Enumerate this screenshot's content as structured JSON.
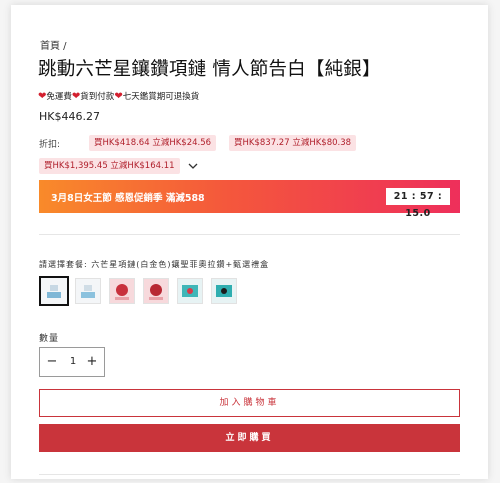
{
  "breadcrumb": "首頁 /",
  "product": {
    "title": "跳動六芒星鑲鑽項鏈 情人節告白【純銀】",
    "benefits": [
      {
        "icon": "heart-icon",
        "text": "免運費"
      },
      {
        "icon": "heart-icon",
        "text": "貨到付款"
      },
      {
        "icon": "heart-icon",
        "text": "七天鑑賞期可退換貨"
      }
    ],
    "price": "HK$446.27"
  },
  "discount": {
    "label": "折扣:",
    "chips": [
      "買HK$418.64 立減HK$24.56",
      "買HK$837.27 立減HK$80.38",
      "買HK$1,395.45 立減HK$164.11"
    ]
  },
  "promo": {
    "text": "3月8日女王節 感恩促銷季 滿減588",
    "timer": "21 : 57 : 15.0"
  },
  "package": {
    "label": "請選擇套餐: 六芒星項鏈(白金色)鑲聖菲奧拉鑽+甄選禮盒",
    "selected_index": 0,
    "options": 7
  },
  "quantity": {
    "label": "數量",
    "value": "1",
    "minus": "−",
    "plus": "+"
  },
  "buttons": {
    "add_to_cart": "加入購物車",
    "buy_now": "立即購買"
  },
  "colors": {
    "accent": "#c9343b",
    "chip_bg": "#fbe2e4",
    "promo_start": "#f98a2a",
    "promo_end": "#ee2f5b"
  }
}
